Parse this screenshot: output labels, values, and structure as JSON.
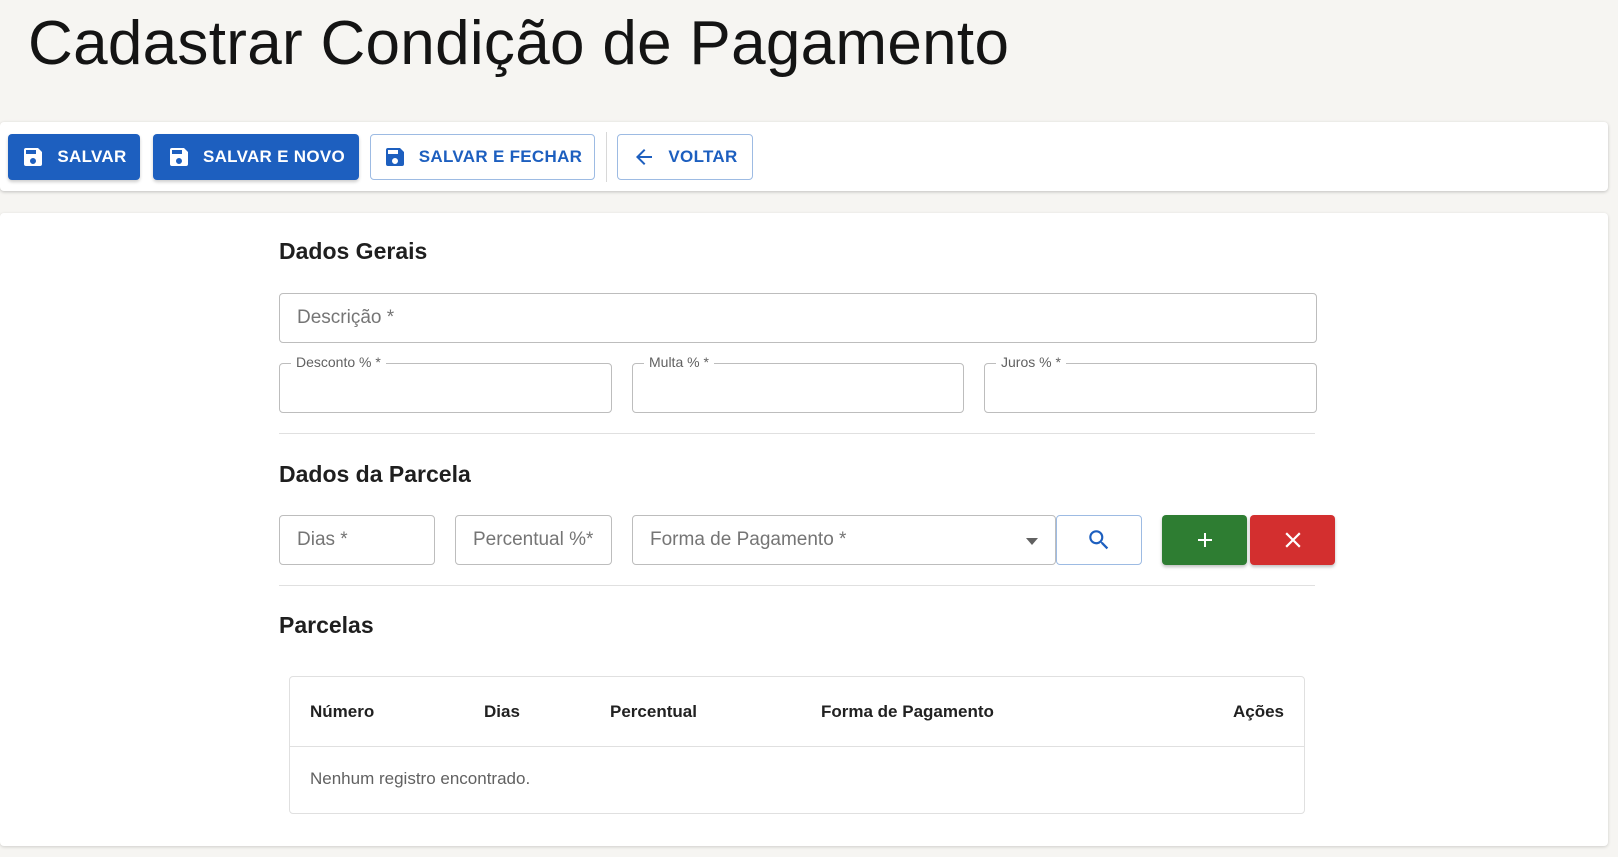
{
  "page": {
    "title": "Cadastrar Condição de Pagamento"
  },
  "toolbar": {
    "save_label": "SALVAR",
    "save_new_label": "SALVAR E NOVO",
    "save_close_label": "SALVAR E FECHAR",
    "back_label": "VOLTAR"
  },
  "general": {
    "title": "Dados Gerais",
    "description_placeholder": "Descrição *",
    "discount_label": "Desconto % *",
    "fine_label": "Multa % *",
    "interest_label": "Juros % *"
  },
  "installment": {
    "title": "Dados da Parcela",
    "days_placeholder": "Dias *",
    "percent_placeholder": "Percentual %*",
    "payment_method_placeholder": "Forma de Pagamento *"
  },
  "installments_table": {
    "title": "Parcelas",
    "columns": [
      "Número",
      "Dias",
      "Percentual",
      "Forma de Pagamento",
      "Ações"
    ],
    "empty_message": "Nenhum registro encontrado."
  },
  "colors": {
    "primary": "#1d5fbf",
    "add_button": "#2e7d32",
    "remove_button": "#d32f2f",
    "background": "#f6f5f2"
  },
  "icons": {
    "save": "save-icon",
    "back": "arrow-left-icon",
    "search": "search-icon",
    "dropdown": "caret-down-icon",
    "add": "plus-icon",
    "remove": "close-icon"
  }
}
